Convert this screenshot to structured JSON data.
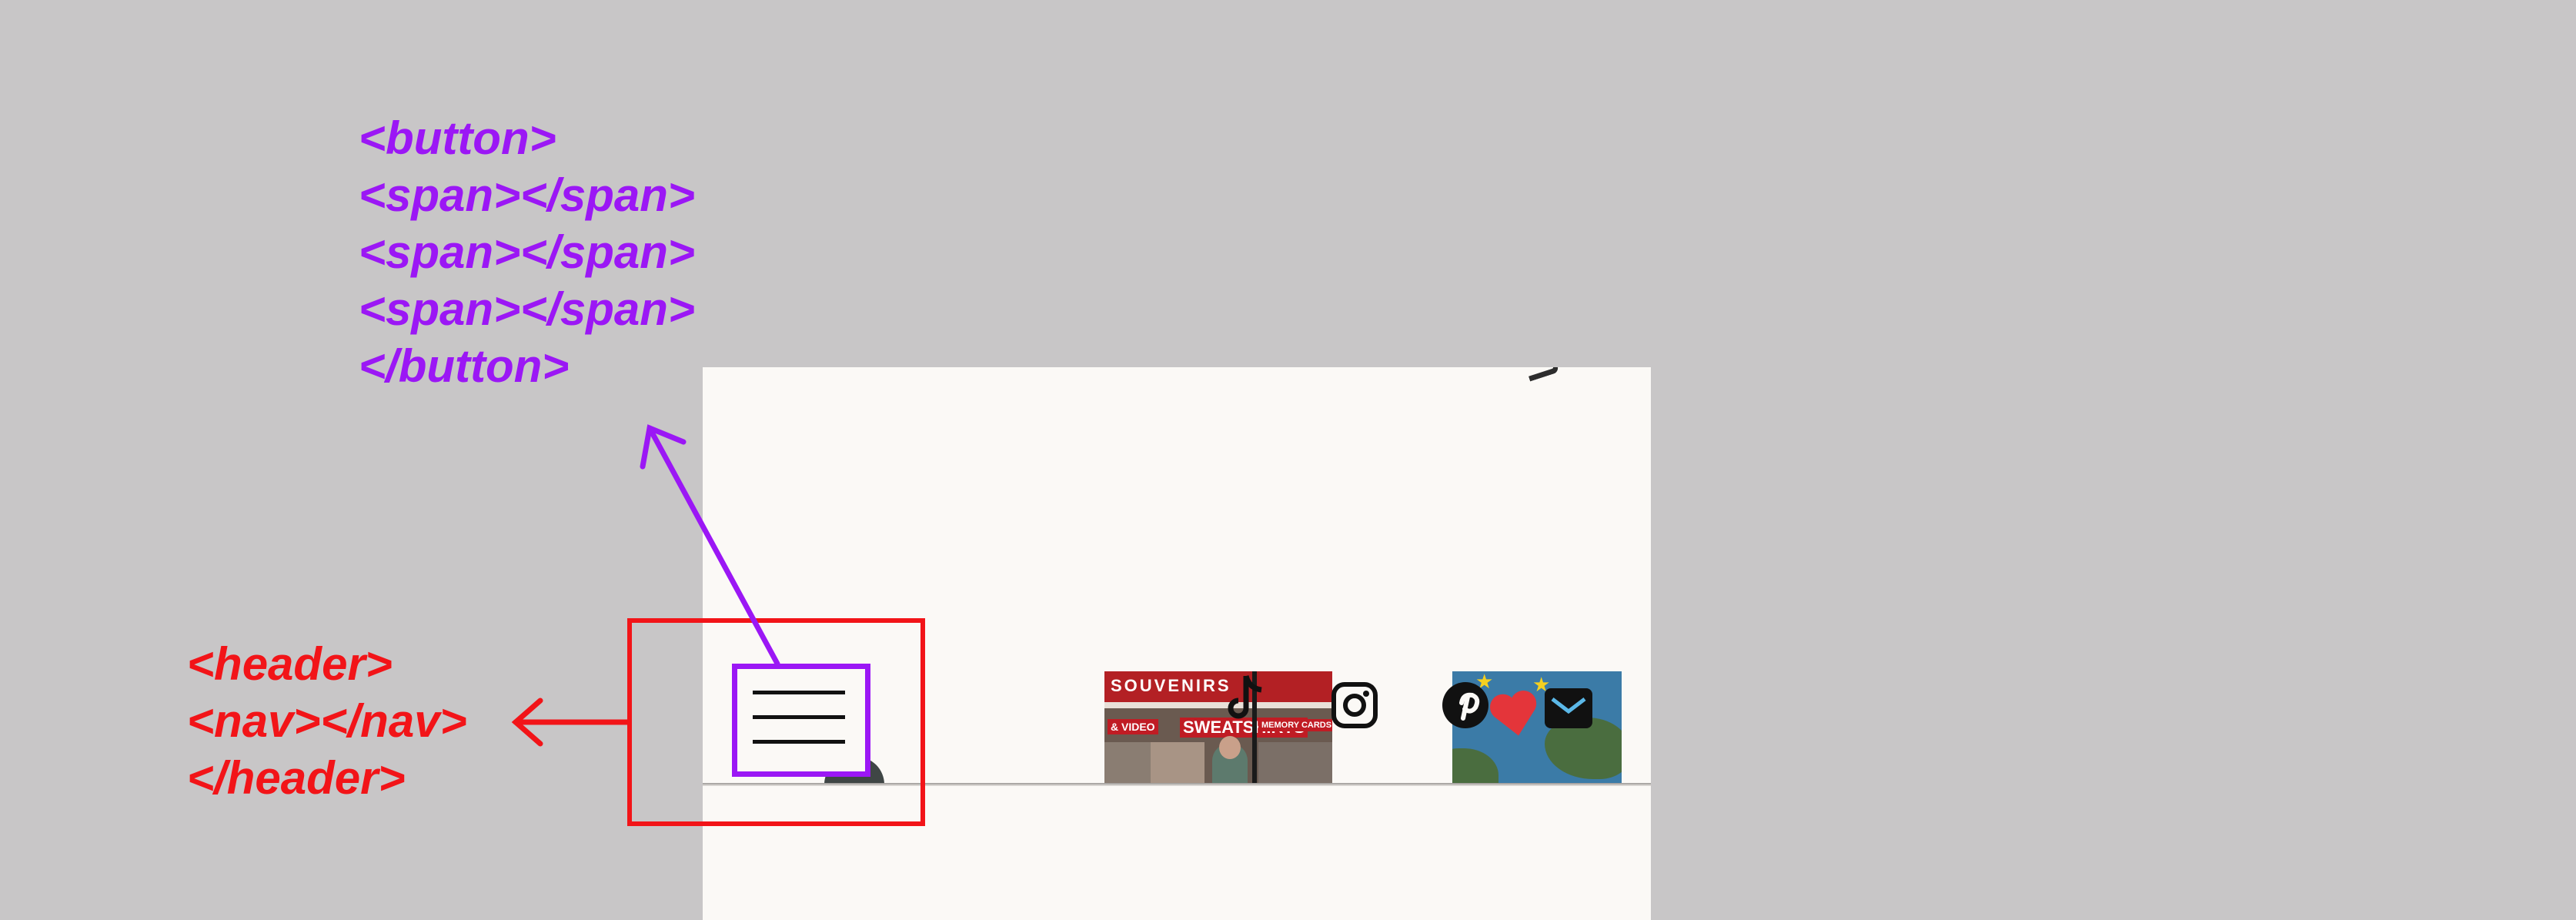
{
  "annotations": {
    "button_code": {
      "lines": [
        "<button>",
        "<span></span>",
        "<span></span>",
        "<span></span>",
        "</button>"
      ],
      "color": "#9b17f5"
    },
    "header_code": {
      "lines": [
        "<header>",
        "<nav></nav>",
        "</header>"
      ],
      "color": "#f21418"
    }
  },
  "mock_page": {
    "hamburger": {
      "icon": "hamburger-menu-icon",
      "bars": 3
    },
    "thumbnail_store": {
      "image": "souvenir-store-photo",
      "sign_main": "SOUVENIRS",
      "sign_a": "& VIDEO",
      "sign_b": "SWEATSHIRTS",
      "sign_c": "MEMORY CARDS"
    },
    "social_icons": [
      "tiktok-icon",
      "instagram-icon",
      "pinterest-icon",
      "mail-icon"
    ],
    "thumbnail_map": {
      "image": "heart-on-map-illustration"
    }
  },
  "colors": {
    "background": "#c8c6c7",
    "page": "#fbf9f6",
    "purple": "#9b17f5",
    "red": "#f21418"
  }
}
